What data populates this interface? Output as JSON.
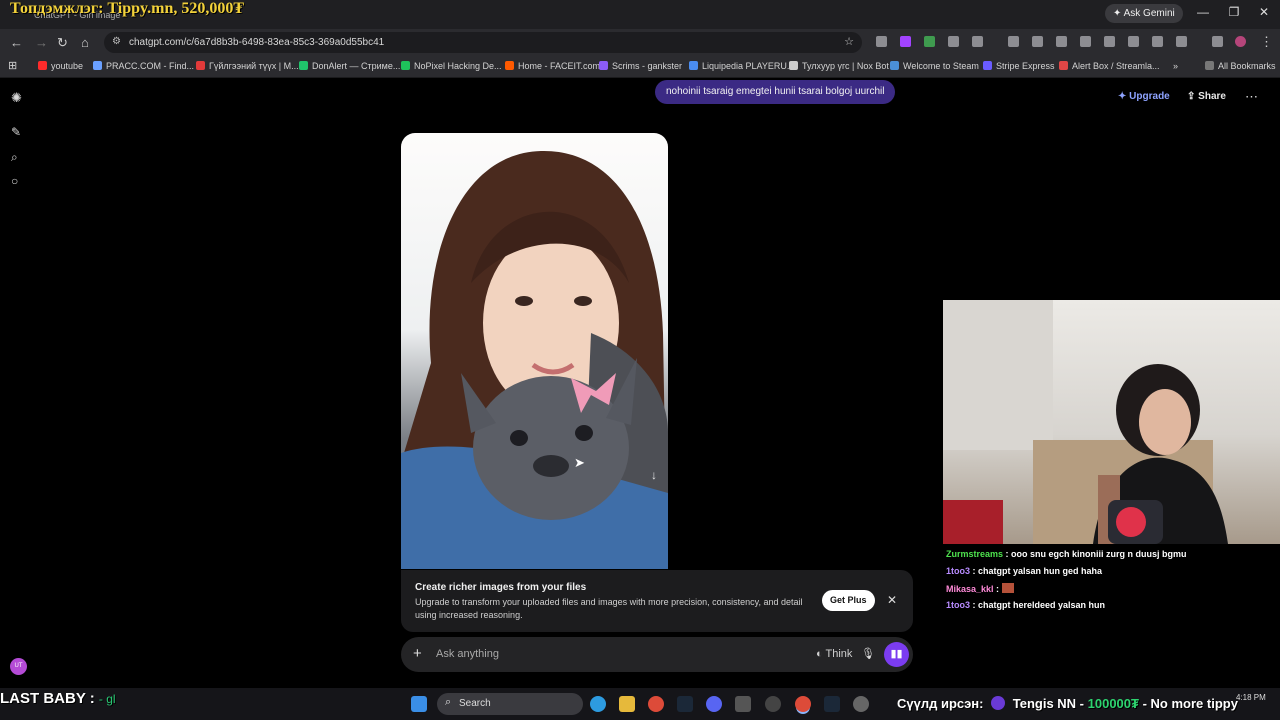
{
  "overlay": {
    "title": "Топдэмжлэг: Tippy.mn, 520,000₮",
    "tab_faint": "ChatGPT - Girl image"
  },
  "window": {
    "ask_gemini": "Ask Gemini"
  },
  "browser": {
    "url": "chatgpt.com/c/6a7d8b3b-6498-83ea-85c3-369a0d55bc41",
    "bookmarks": [
      {
        "label": "youtube",
        "color": "#ff2b2b"
      },
      {
        "label": "PRACC.COM - Find...",
        "color": "#6aa0ff"
      },
      {
        "label": "Гүйлгээний түүх | M...",
        "color": "#e23a3a"
      },
      {
        "label": "DonAlert — Стриме...",
        "color": "#20c46b"
      },
      {
        "label": "NoPixel Hacking De...",
        "color": "#1ec15b"
      },
      {
        "label": "Home - FACEIT.com",
        "color": "#ff5a00"
      },
      {
        "label": "Scrims - gankster",
        "color": "#8b5cf6"
      },
      {
        "label": "Liquipedia PLAYERU...",
        "color": "#4a8cf0"
      },
      {
        "label": "Тулхуур үгс | Nox Bot",
        "color": "#cccccc"
      },
      {
        "label": "Welcome to Steam",
        "color": "#4b8fd6"
      },
      {
        "label": "Stripe Express",
        "color": "#6a5cff"
      },
      {
        "label": "Alert Box / Streamla...",
        "color": "#e04646"
      }
    ],
    "all_bookmarks": "All Bookmarks"
  },
  "chatgpt": {
    "user_message": "nohoinii tsaraig emegtei hunii tsarai bolgoj uurchil",
    "upgrade": "Upgrade",
    "share": "Share",
    "promo": {
      "title": "Create richer images from your files",
      "body": "Upgrade to transform your uploaded files and images with more precision, consistency, and detail using increased reasoning.",
      "button": "Get Plus"
    },
    "composer": {
      "placeholder": "Ask anything",
      "think": "Think"
    },
    "avatar": "UT"
  },
  "stream_chat": [
    {
      "user": "Zurmstreams",
      "color": "#4ee24e",
      "text": "ooo snu egch kinoniii zurg n duusj bgmu"
    },
    {
      "user": "1too3",
      "color": "#b88cff",
      "text": "chatgpt yalsan hun ged haha"
    },
    {
      "user": "Mikasa_kkl",
      "color": "#ff8ad8",
      "text": ""
    },
    {
      "user": "1too3",
      "color": "#b88cff",
      "text": "chatgpt hereldeed yalsan hun"
    }
  ],
  "stream_overlay": {
    "last_baby_label": "LAST BABY :",
    "last_baby_value": "- gl",
    "donation_prefix": "Сүүлд ирсэн:",
    "donation_name": "Tengis NN -",
    "donation_amount": "100000₮",
    "donation_msg": "- No more tippy"
  },
  "taskbar": {
    "search": "Search",
    "time": "4:18 PM"
  }
}
